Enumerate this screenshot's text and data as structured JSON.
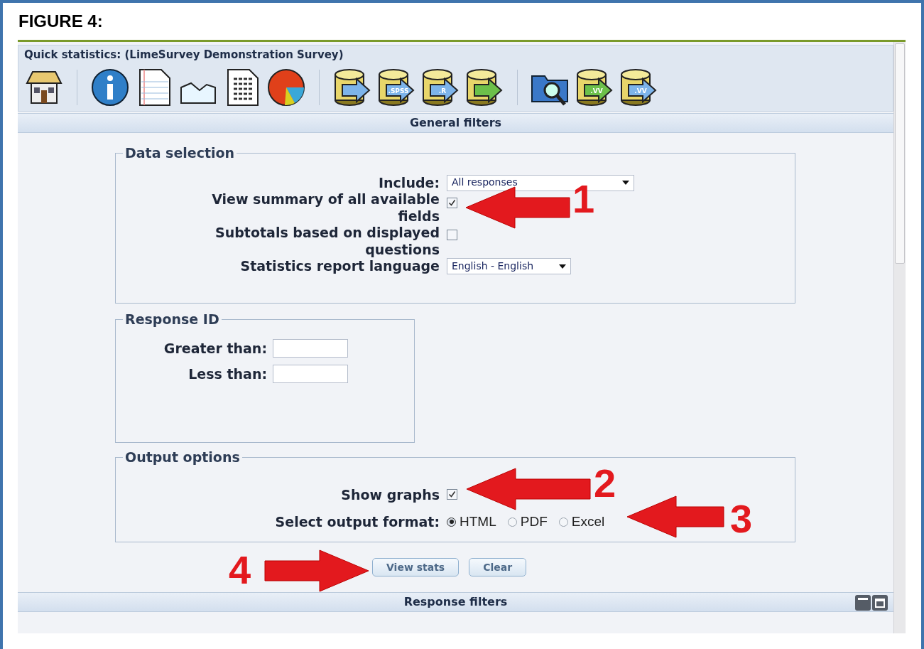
{
  "figure_title": "FIGURE 4:",
  "panel_title": "Quick statistics: (LimeSurvey Demonstration Survey)",
  "toolbar": [
    {
      "kind": "home"
    },
    {
      "kind": "separator"
    },
    {
      "kind": "info"
    },
    {
      "kind": "document"
    },
    {
      "kind": "area"
    },
    {
      "kind": "report"
    },
    {
      "kind": "pie"
    },
    {
      "kind": "separator"
    },
    {
      "kind": "database",
      "color": "#7db4ea"
    },
    {
      "kind": "database",
      "color": "#7db4ea",
      "badge": ".SPSS"
    },
    {
      "kind": "database",
      "color": "#7db4ea",
      "badge": ".R"
    },
    {
      "kind": "database",
      "color": "#6cc04a"
    },
    {
      "kind": "separator"
    },
    {
      "kind": "folder"
    },
    {
      "kind": "database",
      "color": "#6cc04a",
      "badge": ".VV"
    },
    {
      "kind": "database",
      "color": "#7db4ea",
      "badge": ".VV"
    }
  ],
  "general_filters_title": "General filters",
  "data_selection": {
    "legend": "Data selection",
    "rows": [
      {
        "kind": "select",
        "label": "Include:",
        "value": "All responses"
      },
      {
        "kind": "checkbox",
        "label": "View summary of all available fields",
        "checked": true
      },
      {
        "kind": "checkbox",
        "label": "Subtotals based on displayed questions",
        "checked": false
      },
      {
        "kind": "select",
        "label": "Statistics report language",
        "value": "English - English"
      }
    ]
  },
  "response_id": {
    "legend": "Response ID",
    "fields": [
      {
        "label": "Greater than:"
      },
      {
        "label": "Less than:"
      }
    ]
  },
  "output_options": {
    "legend": "Output options",
    "show_graphs": {
      "label": "Show graphs",
      "checked": true
    },
    "format": {
      "label": "Select output format:",
      "options": [
        {
          "label": "HTML",
          "selected": true
        },
        {
          "label": "PDF",
          "selected": false
        },
        {
          "label": "Excel",
          "selected": false
        }
      ]
    }
  },
  "buttons": [
    "View stats",
    "Clear"
  ],
  "response_filters_title": "Response filters",
  "annotations": [
    {
      "label": "1"
    },
    {
      "label": "2"
    },
    {
      "label": "3"
    },
    {
      "label": "4"
    }
  ]
}
